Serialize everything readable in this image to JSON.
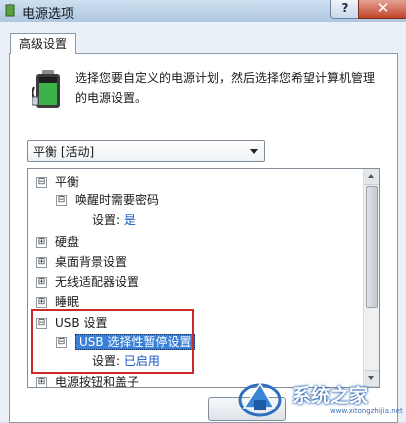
{
  "window": {
    "title": "电源选项",
    "help_label": "?",
    "close_label": "✕"
  },
  "tabs": {
    "advanced": "高级设置"
  },
  "header": {
    "description": "选择您要自定义的电源计划，然后选择您希望计算机管理的电源设置。"
  },
  "plan": {
    "selected": "平衡 [活动]"
  },
  "tree": {
    "items": [
      {
        "label": "平衡",
        "expander": "⊟"
      },
      {
        "label": "唤醒时需要密码",
        "expander": "⊟"
      },
      {
        "label": "设置:",
        "value": "是"
      },
      {
        "label": "硬盘",
        "expander": "⊞"
      },
      {
        "label": "桌面背景设置",
        "expander": "⊞"
      },
      {
        "label": "无线适配器设置",
        "expander": "⊞"
      },
      {
        "label": "睡眠",
        "expander": "⊞"
      },
      {
        "label": "USB 设置",
        "expander": "⊟"
      },
      {
        "label": "USB 选择性暂停设置",
        "expander": "⊟"
      },
      {
        "label": "设置:",
        "value": "已启用"
      },
      {
        "label": "电源按钮和盖子",
        "expander": "⊞"
      }
    ]
  },
  "watermark": {
    "text": "系统之家",
    "url": "www.xitongzhijia.net"
  },
  "colors": {
    "highlight_box": "#cc2a2a",
    "selection": "#3a7fd8",
    "value_text": "#1555c0"
  }
}
